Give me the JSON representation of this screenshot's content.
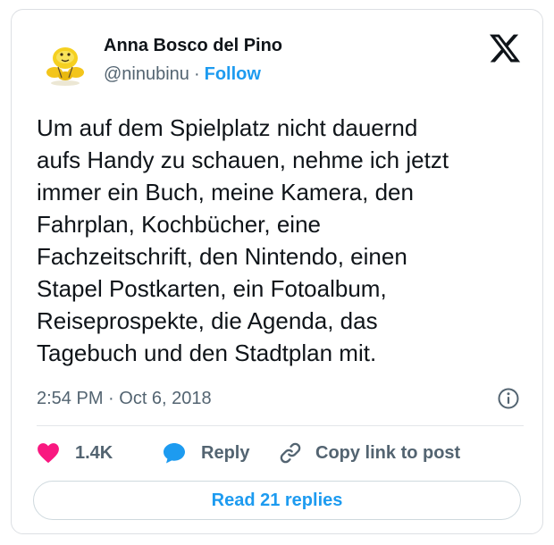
{
  "author": {
    "display_name": "Anna Bosco del Pino",
    "handle": "@ninubinu",
    "separator": "·",
    "follow_label": "Follow",
    "avatar_icon": "lemon-avatar-icon"
  },
  "platform_icon": "x-logo-icon",
  "tweet": {
    "lines": [
      "Um auf dem Spielplatz nicht dauernd",
      "aufs Handy zu schauen, nehme ich jetzt",
      "immer ein Buch, meine Kamera, den",
      "Fahrplan, Kochbücher, eine",
      "Fachzeitschrift, den Nintendo, einen",
      "Stapel Postkarten, ein Fotoalbum,",
      "Reiseprospekte, die Agenda, das",
      "Tagebuch und den Stadtplan mit."
    ],
    "timestamp": "2:54 PM · Oct 6, 2018"
  },
  "actions": {
    "like_count": "1.4K",
    "reply_label": "Reply",
    "copy_link_label": "Copy link to post"
  },
  "read_replies_label": "Read 21 replies",
  "colors": {
    "accent": "#1d9bf0",
    "like": "#f91880",
    "text": "#0f1419",
    "muted": "#536471",
    "border": "#dcdfe3"
  }
}
